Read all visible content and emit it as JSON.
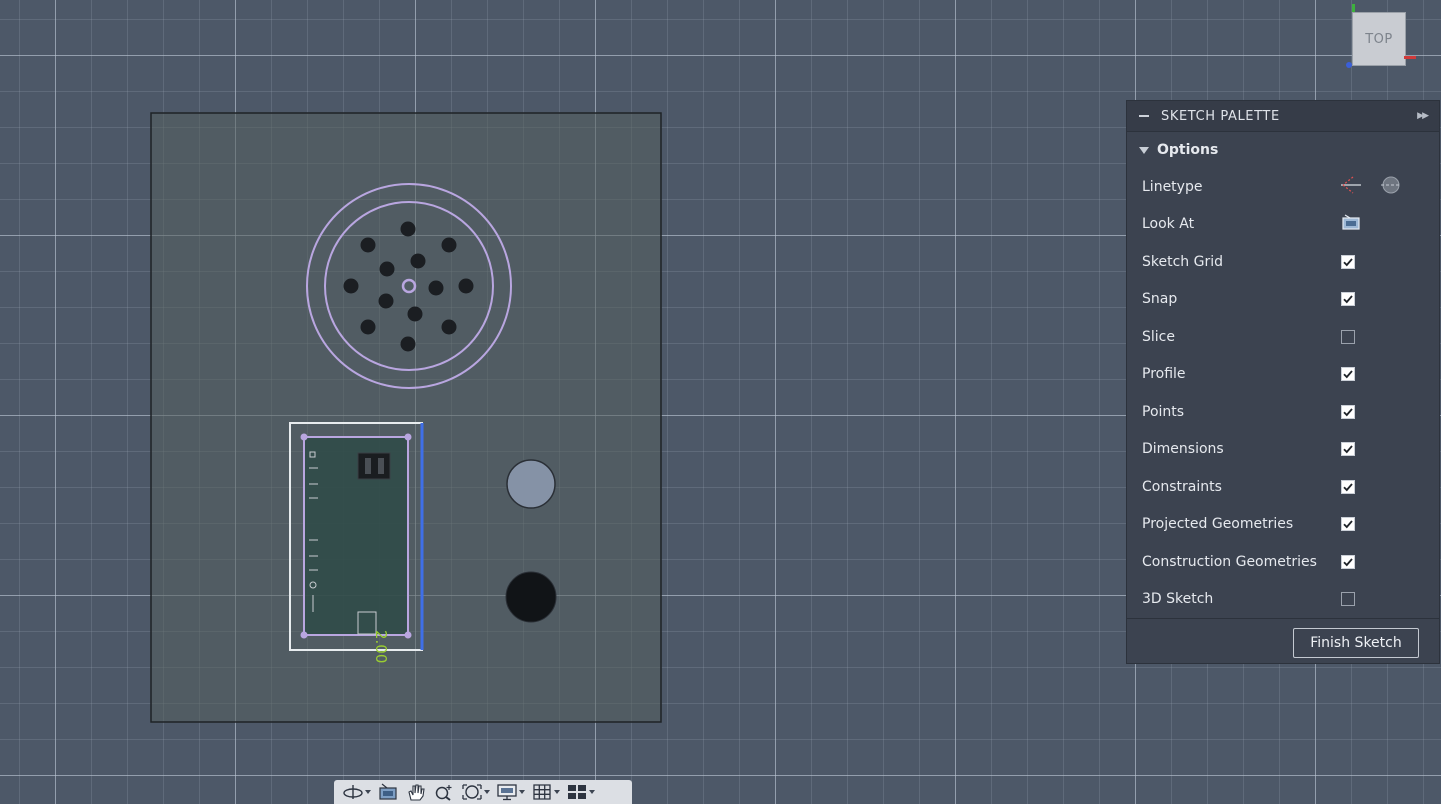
{
  "viewcube": {
    "face_label": "TOP"
  },
  "palette": {
    "title": "SKETCH PALETTE",
    "section_title": "Options",
    "rows": [
      {
        "label": "Linetype",
        "control": "linetype"
      },
      {
        "label": "Look At",
        "control": "lookat"
      },
      {
        "label": "Sketch Grid",
        "control": "checkbox",
        "checked": true
      },
      {
        "label": "Snap",
        "control": "checkbox",
        "checked": true
      },
      {
        "label": "Slice",
        "control": "checkbox",
        "checked": false
      },
      {
        "label": "Profile",
        "control": "checkbox",
        "checked": true
      },
      {
        "label": "Points",
        "control": "checkbox",
        "checked": true
      },
      {
        "label": "Dimensions",
        "control": "checkbox",
        "checked": true
      },
      {
        "label": "Constraints",
        "control": "checkbox",
        "checked": true
      },
      {
        "label": "Projected Geometries",
        "control": "checkbox",
        "checked": true
      },
      {
        "label": "Construction Geometries",
        "control": "checkbox",
        "checked": true
      },
      {
        "label": "3D Sketch",
        "control": "checkbox",
        "checked": false
      }
    ],
    "finish_button": "Finish Sketch"
  },
  "sketch": {
    "dimension_text": "2.00",
    "colors": {
      "profile": "#b9a6e0",
      "dimension": "#9acd32",
      "selection": "#3f6fe8",
      "body": "#55605f"
    }
  },
  "navbar": {
    "tools": [
      {
        "name": "orbit-icon",
        "dropdown": true
      },
      {
        "name": "look-at-icon",
        "dropdown": false
      },
      {
        "name": "pan-icon",
        "dropdown": false
      },
      {
        "name": "zoom-icon",
        "dropdown": false
      },
      {
        "name": "fit-icon",
        "dropdown": true
      },
      {
        "name": "display-settings-icon",
        "dropdown": true
      },
      {
        "name": "grid-icon",
        "dropdown": true
      },
      {
        "name": "viewports-icon",
        "dropdown": true
      }
    ]
  }
}
